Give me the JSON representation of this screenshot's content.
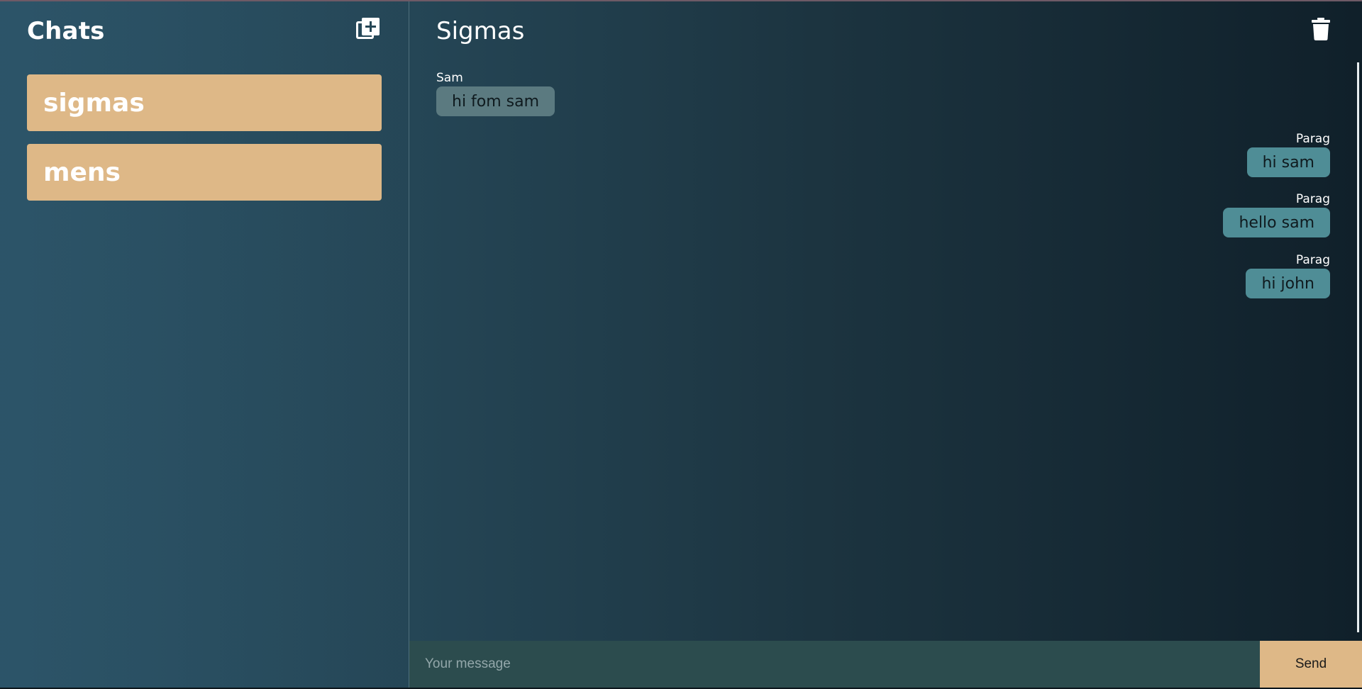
{
  "sidebar": {
    "title": "Chats",
    "new_chat_icon": "add-box-icon",
    "chats": [
      {
        "label": "sigmas"
      },
      {
        "label": "mens"
      }
    ]
  },
  "chat": {
    "title": "Sigmas",
    "delete_icon": "trash-icon",
    "messages": [
      {
        "sender": "Sam",
        "text": "hi fom sam",
        "side": "left"
      },
      {
        "sender": "Parag",
        "text": "hi sam",
        "side": "right"
      },
      {
        "sender": "Parag",
        "text": "hello sam",
        "side": "right"
      },
      {
        "sender": "Parag",
        "text": "hi john",
        "side": "right"
      }
    ]
  },
  "composer": {
    "placeholder": "Your message",
    "value": "",
    "send_label": "Send"
  },
  "colors": {
    "accent": "#deb887",
    "incoming_bubble": "#5b7a80",
    "outgoing_bubble": "#4f8d96",
    "composer_bg": "#2c4c4e"
  }
}
